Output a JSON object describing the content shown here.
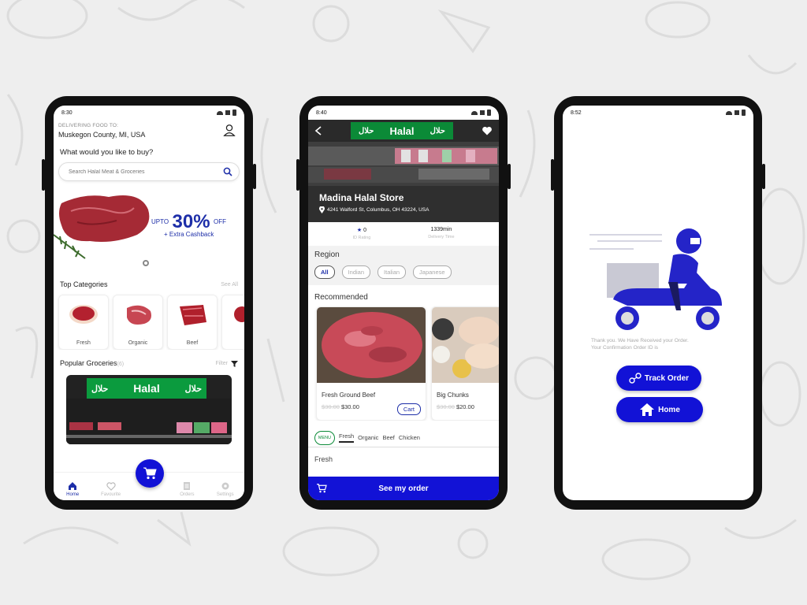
{
  "colors": {
    "accent": "#1212d6",
    "brand": "#1d2ea8",
    "halal_green": "#0b9b3e"
  },
  "phone1": {
    "status": {
      "time": "8:30"
    },
    "delivering_label": "DELIVERING FOOD TO:",
    "location": "Muskegon County, MI, USA",
    "prompt": "What would you like to buy?",
    "search": {
      "placeholder": "Search Halal Meat & Groceries"
    },
    "banner": {
      "upto": "UPTO",
      "percent": "30%",
      "off": "OFF",
      "cashback": "+ Extra Cashback"
    },
    "categories": {
      "title": "Top Categories",
      "link": "See All",
      "items": [
        {
          "label": "Fresh"
        },
        {
          "label": "Organic"
        },
        {
          "label": "Beef"
        },
        {
          "label": "C"
        }
      ]
    },
    "groceries": {
      "title": "Popular Groceries",
      "count": "(6)",
      "filter": "Filter"
    },
    "halal_sign": {
      "english": "Halal",
      "arabic": "حلال"
    },
    "nav": [
      {
        "label": "Home"
      },
      {
        "label": "Favourite"
      },
      {
        "label": "Orders"
      },
      {
        "label": "Settings"
      }
    ]
  },
  "phone2": {
    "status": {
      "time": "8:40"
    },
    "halal_sign": {
      "english": "Halal",
      "arabic": "حلال"
    },
    "store_name": "Madina Halal Store",
    "address": "4241 Walford St, Columbus, OH 43224, USA",
    "stats": [
      {
        "value": "0",
        "label": "ID Rating"
      },
      {
        "value": "1339min",
        "label": "Delivery Time"
      }
    ],
    "region": {
      "title": "Region",
      "chips": [
        "All",
        "Indian",
        "Italian",
        "Japanese"
      ]
    },
    "recommended": {
      "title": "Recommended",
      "items": [
        {
          "name": "Fresh Ground Beef",
          "old_price": "$30.00",
          "price": "$30.00",
          "button": "Cart"
        },
        {
          "name": "Big Chunks",
          "old_price": "$30.00",
          "price": "$20.00"
        }
      ]
    },
    "menu": {
      "circle": "MENU",
      "tabs": [
        "Fresh",
        "Organic",
        "Beef",
        "Chicken"
      ]
    },
    "section": "Fresh",
    "cta": "See my order"
  },
  "phone3": {
    "status": {
      "time": "8:52"
    },
    "thanks_line1": "Thank you. We Have Received your Order.",
    "thanks_line2": "Your Confirmation Order ID is",
    "track_label": "Track Order",
    "home_label": "Home"
  }
}
